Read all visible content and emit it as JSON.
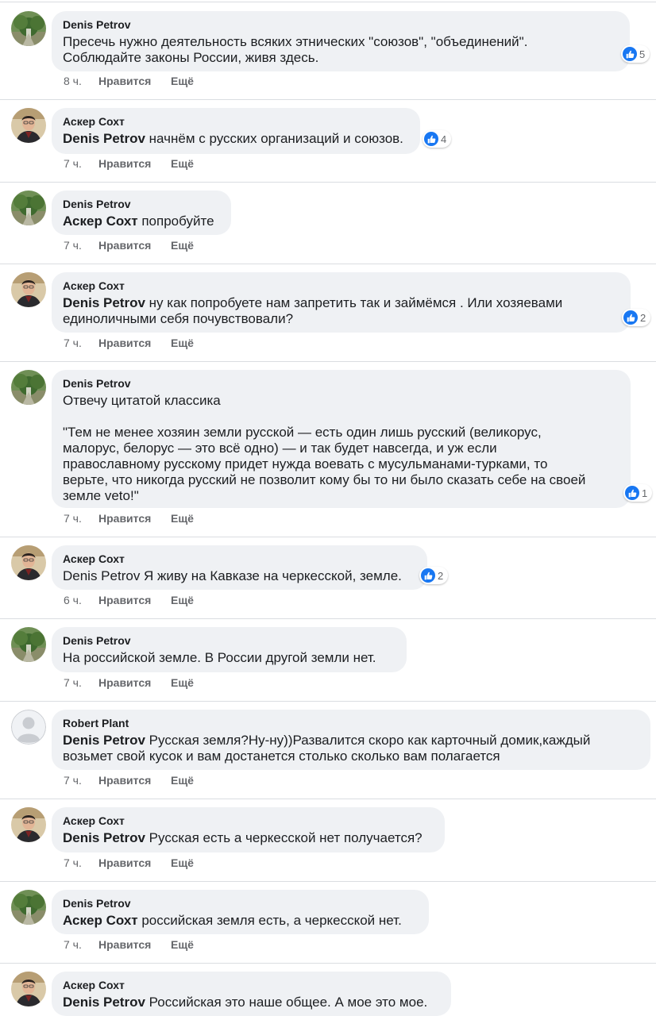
{
  "comments": [
    {
      "author": "Denis Petrov",
      "mention": "",
      "text": "Пресечь нужно деятельность всяких этнических \"союзов\", \"объединений\".\nСоблюдайте законы России, живя здесь.",
      "reactions": "5",
      "time": "8 ч.",
      "like_label": "Нравится",
      "more_label": "Ещё",
      "avatar": "tree"
    },
    {
      "author": "Аскер Сохт",
      "mention": "Denis Petrov",
      "text": "начнём с русских организаций и союзов.",
      "reactions": "4",
      "time": "7 ч.",
      "like_label": "Нравится",
      "more_label": "Ещё",
      "avatar": "person"
    },
    {
      "author": "Denis Petrov",
      "mention": "Аскер Сохт",
      "text": "попробуйте",
      "reactions": "",
      "time": "7 ч.",
      "like_label": "Нравится",
      "more_label": "Ещё",
      "avatar": "tree"
    },
    {
      "author": "Аскер Сохт",
      "mention": "Denis Petrov",
      "text": "ну как попробуете нам запретить так и займёмся . Или хозяевами\nединоличными себя почувствовали?",
      "reactions": "2",
      "time": "7 ч.",
      "like_label": "Нравится",
      "more_label": "Ещё",
      "avatar": "person"
    },
    {
      "author": "Denis Petrov",
      "mention": "",
      "text": "Отвечу цитатой классика\n\n\"Тем не менее хозяин земли русской — есть один лишь русский (великорус,\nмалорус, белорус — это всё одно) — и так будет навсегда, и уж если\nправославному русскому придет нужда воевать с мусульманами-турками, то\nверьте, что никогда русский не позволит кому бы то ни было сказать себе на своей\nземле veto!\"",
      "reactions": "1",
      "time": "7 ч.",
      "like_label": "Нравится",
      "more_label": "Ещё",
      "avatar": "tree"
    },
    {
      "author": "Аскер Сохт",
      "mention": "",
      "text": "Denis Petrov Я живу на Кавказе на черкесской, земле.",
      "reactions": "2",
      "time": "6 ч.",
      "like_label": "Нравится",
      "more_label": "Ещё",
      "avatar": "person"
    },
    {
      "author": "Denis Petrov",
      "mention": "",
      "text": "На российской земле. В России другой земли нет.",
      "reactions": "",
      "time": "7 ч.",
      "like_label": "Нравится",
      "more_label": "Ещё",
      "avatar": "tree"
    },
    {
      "author": "Robert Plant",
      "mention": "Denis Petrov",
      "text": "Русская земля?Ну-ну))Развалится скоро как карточный домик,каждый\nвозьмет свой кусок и вам достанется столько сколько вам полагается",
      "reactions": "",
      "time": "7 ч.",
      "like_label": "Нравится",
      "more_label": "Ещё",
      "avatar": "blank"
    },
    {
      "author": "Аскер Сохт",
      "mention": "Denis Petrov",
      "text": "Русская есть а черкесской нет получается?",
      "reactions": "",
      "time": "7 ч.",
      "like_label": "Нравится",
      "more_label": "Ещё",
      "avatar": "person"
    },
    {
      "author": "Denis Petrov",
      "mention": "Аскер Сохт",
      "text": "российская земля есть, а черкесской нет.",
      "reactions": "",
      "time": "7 ч.",
      "like_label": "Нравится",
      "more_label": "Ещё",
      "avatar": "tree"
    },
    {
      "author": "Аскер Сохт",
      "mention": "Denis Petrov",
      "text": "Российская это наше общее. А мое это мое.",
      "reactions": "",
      "time": "",
      "like_label": "",
      "more_label": "",
      "avatar": "person"
    }
  ],
  "colors": {
    "bubble": "#eff1f4",
    "like_blue": "#1877f2",
    "meta_gray": "#65676b",
    "separator": "#dadde1"
  },
  "icons": {
    "reaction": "thumbs-up-icon"
  }
}
